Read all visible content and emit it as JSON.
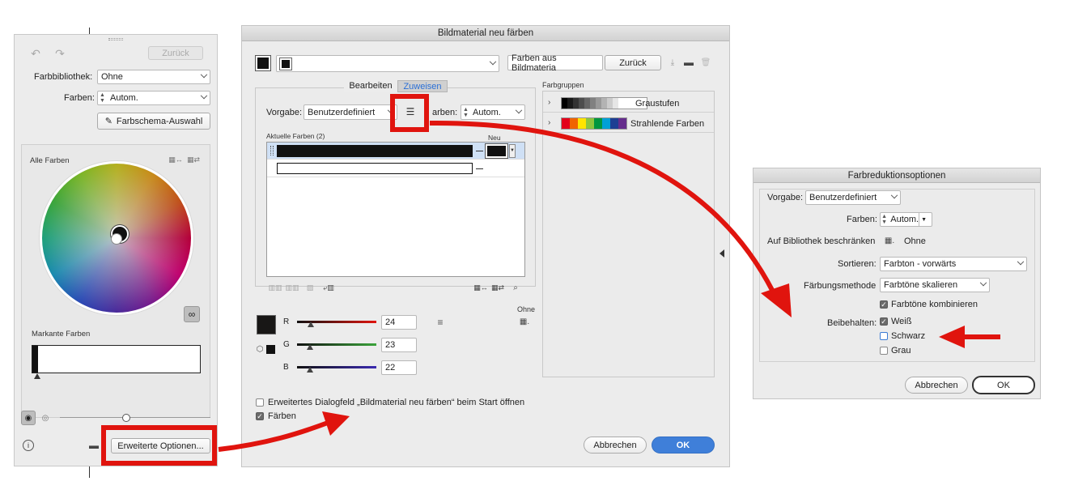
{
  "left_panel": {
    "back_button": "Zurück",
    "library_label": "Farbbibliothek:",
    "library_value": "Ohne",
    "colors_label": "Farben:",
    "colors_value": "Autom.",
    "harmony_button": "Farbschema-Auswahl",
    "all_colors_label": "Alle Farben",
    "prominent_colors_label": "Markante Farben",
    "advanced_button": "Erweiterte Optionen...",
    "slider_value": 0.55
  },
  "recolor_dialog": {
    "title": "Bildmaterial neu färben",
    "colors_from_art_button": "Farben aus Bildmateria",
    "back_button": "Zurück",
    "tabs": [
      {
        "label": "Bearbeiten",
        "active": false
      },
      {
        "label": "Zuweisen",
        "active": true
      }
    ],
    "preset_label": "Vorgabe:",
    "preset_value": "Benutzerdefiniert",
    "colors_label": "Farben:",
    "colors_label_visible": "arben:",
    "colors_value": "Autom.",
    "current_colors_label": "Aktuelle Farben (2)",
    "new_label": "Neu",
    "rows": [
      {
        "current": "#111111",
        "new": "#111111"
      },
      {
        "current": "#ffffff",
        "new": ""
      }
    ],
    "none_label": "Ohne",
    "rgb": [
      {
        "channel": "R",
        "value": "24",
        "color": "#e0140e"
      },
      {
        "channel": "G",
        "value": "23",
        "color": "#3aa33a"
      },
      {
        "channel": "B",
        "value": "22",
        "color": "#3a2ab0"
      }
    ],
    "swatch_color": "#181716",
    "color_groups_label": "Farbgruppen",
    "groups": [
      {
        "name": "Graustufen",
        "swatches": [
          "#000000",
          "#1a1a1a",
          "#333333",
          "#4d4d4d",
          "#666666",
          "#808080",
          "#999999",
          "#b3b3b3",
          "#cccccc",
          "#e6e6e6",
          "#ffffff",
          "#ffffff"
        ]
      },
      {
        "name": "Strahlende Farben",
        "swatches": [
          "#e3001b",
          "#f06400",
          "#ffe500",
          "#8cc63e",
          "#00963f",
          "#00a0d7",
          "#1d3f93",
          "#652d8c"
        ]
      }
    ],
    "open_at_start_checkbox": "Erweitertes Dialogfeld „Bildmaterial neu färben“ beim Start öffnen",
    "open_at_start_checked": false,
    "recolor_checkbox": "Färben",
    "recolor_checked": true,
    "cancel_button": "Abbrechen",
    "ok_button": "OK"
  },
  "reduction_dialog": {
    "title": "Farbreduktionsoptionen",
    "preset_label": "Vorgabe:",
    "preset_value": "Benutzerdefiniert",
    "colors_label": "Farben:",
    "colors_value": "Autom.",
    "limit_label": "Auf Bibliothek beschränken",
    "limit_value": "Ohne",
    "sort_label": "Sortieren:",
    "sort_value": "Farbton - vorwärts",
    "method_label": "Färbungsmethode",
    "method_value": "Farbtöne skalieren",
    "combine_label": "Farbtöne kombinieren",
    "combine_checked": true,
    "preserve_label": "Beibehalten:",
    "preserve": [
      {
        "label": "Weiß",
        "checked": true
      },
      {
        "label": "Schwarz",
        "checked": false
      },
      {
        "label": "Grau",
        "checked": false
      }
    ],
    "cancel_button": "Abbrechen",
    "ok_button": "OK"
  },
  "annotation_color": "#e0140e"
}
